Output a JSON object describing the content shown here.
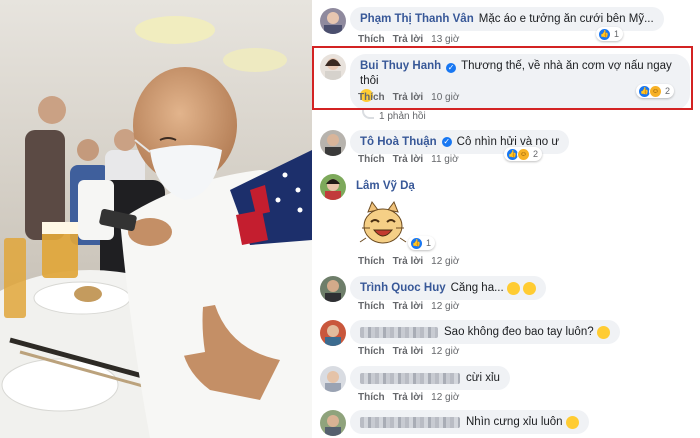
{
  "photo": {
    "description_icon": "photo-image-icon"
  },
  "comments": [
    {
      "name": "Phạm Thị Thanh Vân",
      "verified": false,
      "text": "Mặc áo e tưởng ăn cưới bên Mỹ...",
      "like_label": "Thích",
      "reply_label": "Trả lời",
      "time": "13 giờ",
      "reaction_count": "1"
    },
    {
      "name": "Bui Thuy Hanh",
      "verified": true,
      "text": "Thương thế, về nhà ăn cơm vợ nấu ngay thôi",
      "like_label": "Thích",
      "reply_label": "Trả lời",
      "time": "10 giờ",
      "reaction_count": "2",
      "replies_label": "1 phản hồi"
    },
    {
      "name": "Tô Hoà Thuận",
      "verified": true,
      "text": "Cô nhìn hửi và no ư",
      "like_label": "Thích",
      "reply_label": "Trả lời",
      "time": "11 giờ",
      "reaction_count": "2"
    },
    {
      "name": "Lâm Vỹ Dạ",
      "verified": false,
      "text": "",
      "like_label": "Thích",
      "reply_label": "Trả lời",
      "time": "12 giờ",
      "reaction_count": "1",
      "sticker_icon": "laughing-cat-sticker-icon"
    },
    {
      "name": "Trình Quoc Huy",
      "verified": false,
      "text": "Căng ha...",
      "like_label": "Thích",
      "reply_label": "Trả lời",
      "time": "12 giờ"
    },
    {
      "name": "",
      "verified": false,
      "text": "Sao không đeo bao tay luôn?",
      "like_label": "Thích",
      "reply_label": "Trả lời",
      "time": "12 giờ"
    },
    {
      "name": "",
      "verified": false,
      "text": "cừi xỉu",
      "like_label": "Thích",
      "reply_label": "Trả lời",
      "time": "12 giờ"
    },
    {
      "name": "",
      "verified": false,
      "text": "Nhìn cưng xỉu luôn"
    }
  ],
  "colors": {
    "name_link": "#385898",
    "bubble_bg": "#f0f2f5",
    "highlight_border": "#d32323",
    "like_blue": "#1877f2"
  }
}
